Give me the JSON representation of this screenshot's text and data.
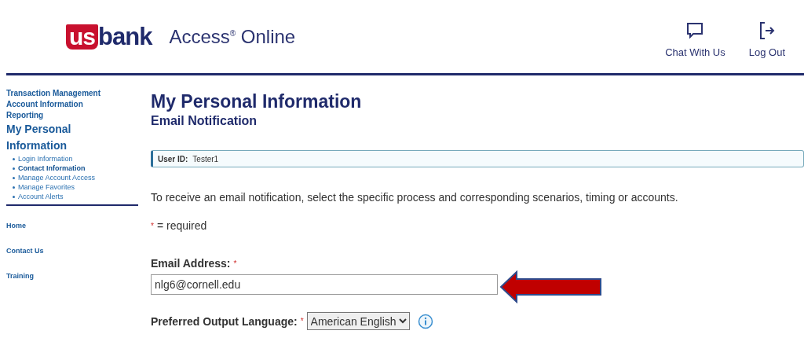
{
  "header": {
    "logo": {
      "mark": "us",
      "word": "bank"
    },
    "product": "Access$^{®}$ Online",
    "actions": [
      {
        "kind": "chat",
        "label": "Chat With Us"
      },
      {
        "kind": "logout",
        "label": "Log Out"
      }
    ]
  },
  "sidebar": {
    "items": [
      {
        "kind": "link",
        "label": "Transaction Management"
      },
      {
        "kind": "link",
        "label": "Account Information"
      },
      {
        "kind": "link",
        "label": "Reporting"
      },
      {
        "kind": "heading",
        "label": "My Personal Information",
        "children": [
          {
            "label": "Login Information",
            "selected": false
          },
          {
            "label": "Contact Information",
            "selected": true
          },
          {
            "label": "Manage Account Access",
            "selected": false
          },
          {
            "label": "Manage Favorites",
            "selected": false
          },
          {
            "label": "Account Alerts",
            "selected": false
          }
        ]
      }
    ],
    "footer_links": [
      "Home",
      "Contact Us",
      "Training"
    ]
  },
  "main": {
    "title": "My Personal Information",
    "subtitle": "Email Notification",
    "user_id": {
      "label": "User ID:",
      "value": "Tester1"
    },
    "intro": "To receive an email notification, select the specific process and corresponding scenarios, timing or accounts.",
    "required_note": {
      "mark": "*",
      "text": "= required"
    },
    "fields": [
      {
        "kind": "text",
        "label": "Email Address:",
        "required_mark": "*",
        "value": "nlg6@cornell.edu"
      },
      {
        "kind": "select",
        "label": "Preferred Output Language:",
        "required_mark": "*",
        "value": "American English"
      }
    ]
  }
}
